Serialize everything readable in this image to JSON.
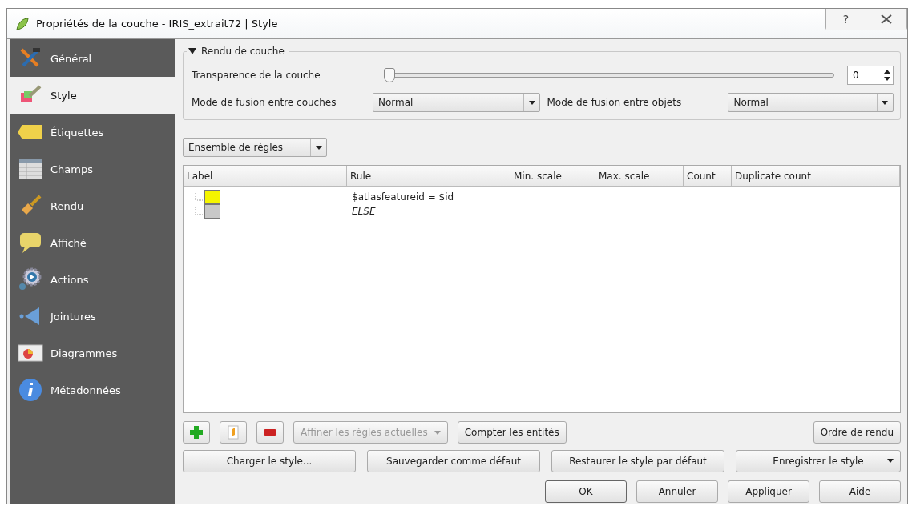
{
  "window": {
    "title": "Propriétés de la couche - IRIS_extrait72 | Style",
    "help": "?"
  },
  "sidebar": {
    "items": [
      {
        "label": "Général",
        "selected": false
      },
      {
        "label": "Style",
        "selected": true
      },
      {
        "label": "Étiquettes",
        "selected": false
      },
      {
        "label": "Champs",
        "selected": false
      },
      {
        "label": "Rendu",
        "selected": false
      },
      {
        "label": "Affiché",
        "selected": false
      },
      {
        "label": "Actions",
        "selected": false
      },
      {
        "label": "Jointures",
        "selected": false
      },
      {
        "label": "Diagrammes",
        "selected": false
      },
      {
        "label": "Métadonnées",
        "selected": false
      }
    ]
  },
  "layer_rendering": {
    "title": "Rendu de couche",
    "expanded": true,
    "transparency_label": "Transparence de la couche",
    "transparency": {
      "level": 0,
      "value": "0"
    },
    "blend_layers_label": "Mode de fusion entre couches",
    "blend_layers_value": "Normal",
    "blend_objects_label": "Mode de fusion entre objets",
    "blend_objects_value": "Normal"
  },
  "renderer_type": "Ensemble de règles",
  "rules_table": {
    "columns": [
      "Label",
      "Rule",
      "Min. scale",
      "Max. scale",
      "Count",
      "Duplicate count"
    ],
    "rows": [
      {
        "kind": "rule",
        "color": "#f5f500",
        "rule": "$atlasfeatureid = $id"
      },
      {
        "kind": "else",
        "color": "#c8c8c8",
        "rule": "ELSE"
      }
    ]
  },
  "rule_toolbar": {
    "refine": {
      "label": "Affiner les règles actuelles",
      "disabled": true
    },
    "count": "Compter les entités",
    "order": "Ordre de rendu"
  },
  "style_buttons": [
    {
      "label": "Charger le style...",
      "dropdown": false
    },
    {
      "label": "Sauvegarder comme défaut",
      "dropdown": false
    },
    {
      "label": "Restaurer le style par défaut",
      "dropdown": false
    },
    {
      "label": "Enregistrer le style",
      "dropdown": true
    }
  ],
  "dialog_buttons": [
    {
      "label": "OK",
      "default": true
    },
    {
      "label": "Annuler",
      "default": false
    },
    {
      "label": "Appliquer",
      "default": false
    },
    {
      "label": "Aide",
      "default": false
    }
  ]
}
